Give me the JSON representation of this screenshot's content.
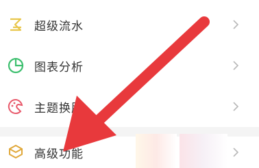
{
  "menu": {
    "items": [
      {
        "label": "超级流水",
        "icon": "flow-icon",
        "color": "#e8c64a"
      },
      {
        "label": "图表分析",
        "icon": "pie-chart-icon",
        "color": "#3cbf6e"
      },
      {
        "label": "主题换肤",
        "icon": "palette-icon",
        "color": "#e8586a"
      },
      {
        "label": "高级功能",
        "icon": "crown-icon",
        "color": "#e0a83a"
      }
    ]
  },
  "annotation": {
    "arrow_color": "#e8393c"
  }
}
